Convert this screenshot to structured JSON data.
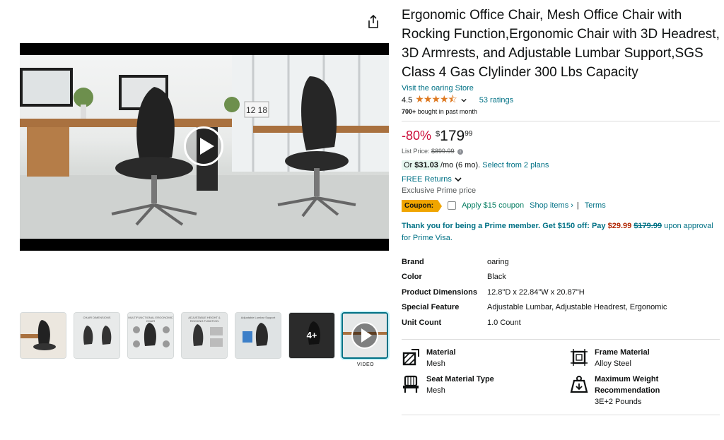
{
  "product": {
    "title": "Ergonomic Office Chair, Mesh Office Chair with Rocking Function,Ergonomic Chair with 3D Headrest, 3D Armrests, and Adjustable Lumbar Support,SGS Class 4 Gas Clylinder 300 Lbs Capacity",
    "store_link": "Visit the oaring Store",
    "rating_value": "4.5",
    "rating_stars": "★★★★⯪",
    "ratings_count": "53 ratings",
    "bought_bold": "700+",
    "bought_rest": " bought in past month"
  },
  "pricing": {
    "discount": "-80%",
    "currency": "$",
    "dollars": "179",
    "cents": "99",
    "list_price_label": "List Price: ",
    "list_price": "$899.99",
    "info_glyph": "i",
    "installment_or": "Or ",
    "installment_amount": "$31.03",
    "installment_term": "/mo (6 mo). ",
    "installment_link": "Select from 2 plans",
    "returns": "FREE Returns",
    "exclusive": "Exclusive Prime price"
  },
  "coupon": {
    "badge": "Coupon:",
    "apply": "Apply $15 coupon",
    "shop": "Shop items ›",
    "separator": "|",
    "terms": "Terms"
  },
  "prime_offer": {
    "lead": "Thank you for being a Prime member. Get $150 off: Pay ",
    "price": "$29.99",
    "space": " ",
    "strike": "$179.99",
    "tail": " upon approval for Prime Visa."
  },
  "specs": [
    {
      "key": "Brand",
      "value": "oaring"
    },
    {
      "key": "Color",
      "value": "Black"
    },
    {
      "key": "Product Dimensions",
      "value": "12.8\"D x 22.84\"W x 20.87\"H"
    },
    {
      "key": "Special Feature",
      "value": "Adjustable Lumbar, Adjustable Headrest, Ergonomic"
    },
    {
      "key": "Unit Count",
      "value": "1.0 Count"
    }
  ],
  "features": [
    {
      "key": "Material",
      "value": "Mesh",
      "icon": "material-icon"
    },
    {
      "key": "Frame Material",
      "value": "Alloy Steel",
      "icon": "frame-icon"
    },
    {
      "key": "Seat Material Type",
      "value": "Mesh",
      "icon": "seat-icon"
    },
    {
      "key": "Maximum Weight Recommendation",
      "value": "3E+2 Pounds",
      "icon": "weight-icon"
    }
  ],
  "media": {
    "video_clock": "12 18",
    "thumb_captions": [
      "",
      "CHAIR DIMENSIONS",
      "MULTIFUNCTIONAL ERGONOMIC CHAIR",
      "ADJUSTABLE HEIGHT & ROCKING FUNCTION",
      "Adjustable Lumbar Support",
      "",
      ""
    ],
    "more_count": "4+",
    "video_label": "VIDEO"
  },
  "colors": {
    "link": "#007185",
    "discount": "#cc0c39",
    "star": "#de7921",
    "coupon": "#f0a500",
    "prime_price": "#b12704"
  }
}
